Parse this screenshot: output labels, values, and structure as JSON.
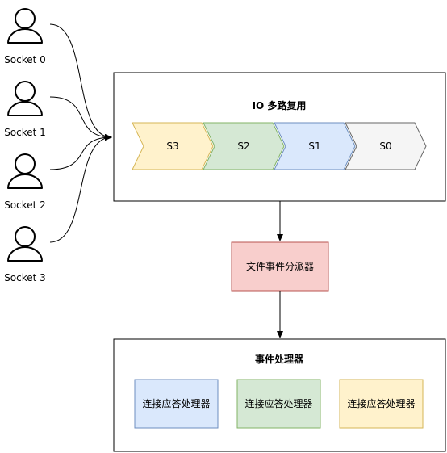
{
  "sockets": [
    {
      "label": "Socket 0"
    },
    {
      "label": "Socket 1"
    },
    {
      "label": "Socket 2"
    },
    {
      "label": "Socket 3"
    }
  ],
  "io_multiplexing": {
    "title": "IO 多路复用",
    "queue": [
      {
        "label": "S3",
        "fill": "#fff2cc",
        "stroke": "#d6b656"
      },
      {
        "label": "S2",
        "fill": "#d5e8d4",
        "stroke": "#82b366"
      },
      {
        "label": "S1",
        "fill": "#dae8fc",
        "stroke": "#6c8ebf"
      },
      {
        "label": "S0",
        "fill": "#f5f5f5",
        "stroke": "#666666"
      }
    ]
  },
  "dispatcher": {
    "label": "文件事件分派器",
    "fill": "#f8cecc",
    "stroke": "#b85450"
  },
  "event_handlers": {
    "title": "事件处理器",
    "handlers": [
      {
        "label": "连接应答处理器",
        "fill": "#dae8fc",
        "stroke": "#6c8ebf"
      },
      {
        "label": "连接应答处理器",
        "fill": "#d5e8d4",
        "stroke": "#82b366"
      },
      {
        "label": "连接应答处理器",
        "fill": "#fff2cc",
        "stroke": "#d6b656"
      }
    ]
  }
}
